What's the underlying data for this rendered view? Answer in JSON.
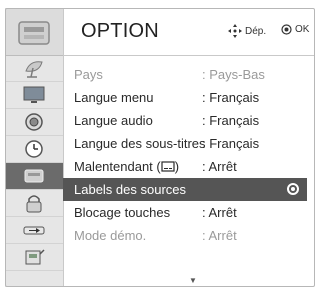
{
  "header": {
    "title": "OPTION",
    "nav_hint": "Dép.",
    "ok_hint": "OK"
  },
  "rail": {
    "icons": [
      "option-menu-icon",
      "satellite-dish-icon",
      "monitor-icon",
      "speaker-icon",
      "clock-icon",
      "option-icon",
      "lock-icon",
      "input-icon",
      "usb-icon"
    ]
  },
  "options": [
    {
      "label": "Pays",
      "value": ": Pays-Bas",
      "state": "dim"
    },
    {
      "label": "Langue menu",
      "value": ": Français",
      "state": "normal"
    },
    {
      "label": "Langue audio",
      "value": ": Français",
      "state": "normal"
    },
    {
      "label": "Langue des sous-titres",
      "value": ": Français",
      "state": "normal"
    },
    {
      "label": "Malentendant (",
      "value": ": Arrêt",
      "state": "normal"
    },
    {
      "label": "Labels des sources",
      "value": "",
      "state": "selected"
    },
    {
      "label": "Blocage touches",
      "value": ": Arrêt",
      "state": "normal"
    },
    {
      "label": "Mode démo.",
      "value": ": Arrêt",
      "state": "dim"
    }
  ],
  "colors": {
    "selected_bg": "#555555",
    "rail_active": "#6b6b6b",
    "dim_text": "#9a9a9a"
  }
}
